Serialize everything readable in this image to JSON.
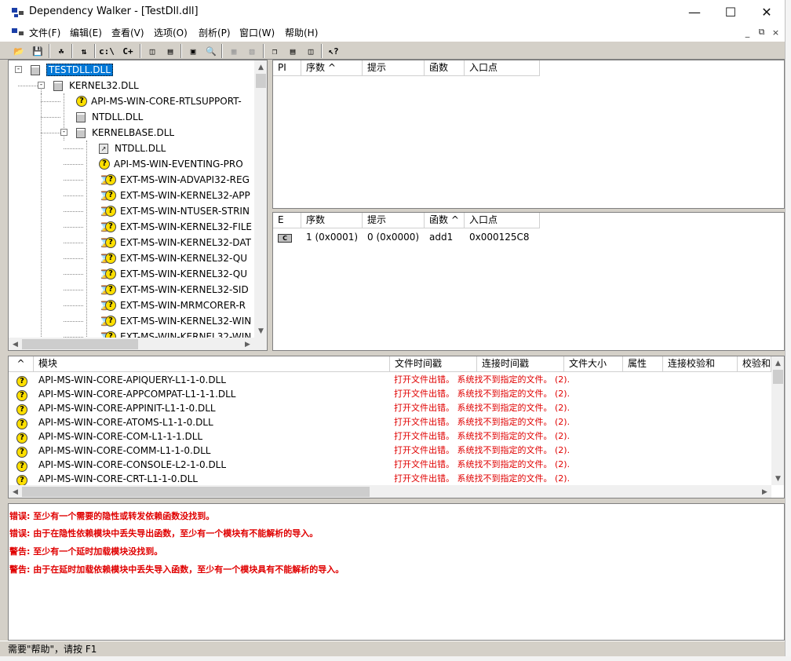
{
  "window": {
    "title": "Dependency Walker - [TestDll.dll]"
  },
  "menu": [
    "文件(F)",
    "编辑(E)",
    "查看(V)",
    "选项(O)",
    "剖析(P)",
    "窗口(W)",
    "帮助(H)"
  ],
  "tree": {
    "nodes": [
      {
        "label": "TESTDLL.DLL",
        "icon": "module-icon",
        "selected": true
      },
      {
        "label": "KERNEL32.DLL",
        "icon": "module-icon"
      },
      {
        "label": "API-MS-WIN-CORE-RTLSUPPORT-",
        "icon": "missing-module-icon"
      },
      {
        "label": "NTDLL.DLL",
        "icon": "module-icon"
      },
      {
        "label": "KERNELBASE.DLL",
        "icon": "module-icon"
      },
      {
        "label": "NTDLL.DLL",
        "icon": "forwarded-module-icon"
      },
      {
        "label": "API-MS-WIN-EVENTING-PRO",
        "icon": "missing-module-icon"
      },
      {
        "label": "EXT-MS-WIN-ADVAPI32-REG",
        "icon": "delay-missing-icon"
      },
      {
        "label": "EXT-MS-WIN-KERNEL32-APP",
        "icon": "delay-missing-icon"
      },
      {
        "label": "EXT-MS-WIN-NTUSER-STRIN",
        "icon": "delay-missing-icon"
      },
      {
        "label": "EXT-MS-WIN-KERNEL32-FILE",
        "icon": "delay-missing-icon"
      },
      {
        "label": "EXT-MS-WIN-KERNEL32-DAT",
        "icon": "delay-missing-icon"
      },
      {
        "label": "EXT-MS-WIN-KERNEL32-QU",
        "icon": "delay-missing-icon"
      },
      {
        "label": "EXT-MS-WIN-KERNEL32-QU",
        "icon": "delay-missing-icon"
      },
      {
        "label": "EXT-MS-WIN-KERNEL32-SID",
        "icon": "delay-missing-icon"
      },
      {
        "label": "EXT-MS-WIN-MRMCORER-R",
        "icon": "delay-missing-icon"
      },
      {
        "label": "EXT-MS-WIN-KERNEL32-WIN",
        "icon": "delay-missing-icon"
      },
      {
        "label": "EXT-MS-WIN-KERNEL32-WIN",
        "icon": "delay-missing-icon"
      }
    ]
  },
  "import_list": {
    "headers": [
      "PI",
      "序数 ^",
      "提示",
      "函数",
      "入口点"
    ]
  },
  "export_list": {
    "headers": [
      "E",
      "序数",
      "提示",
      "函数 ^",
      "入口点"
    ],
    "rows": [
      {
        "icon": "c-function-icon",
        "ordinal": "1 (0x0001)",
        "hint": "0 (0x0000)",
        "function": "add1",
        "entry": "0x000125C8"
      }
    ]
  },
  "module_list": {
    "headers": [
      "^",
      "模块",
      "文件时间戳",
      "连接时间戳",
      "文件大小",
      "属性",
      "连接校验和",
      "校验和"
    ],
    "rows": [
      {
        "module": "API-MS-WIN-CORE-APIQUERY-L1-1-0.DLL",
        "error": "打开文件出错。 系统找不到指定的文件。 (2)."
      },
      {
        "module": "API-MS-WIN-CORE-APPCOMPAT-L1-1-1.DLL",
        "error": "打开文件出错。 系统找不到指定的文件。 (2)."
      },
      {
        "module": "API-MS-WIN-CORE-APPINIT-L1-1-0.DLL",
        "error": "打开文件出错。 系统找不到指定的文件。 (2)."
      },
      {
        "module": "API-MS-WIN-CORE-ATOMS-L1-1-0.DLL",
        "error": "打开文件出错。 系统找不到指定的文件。 (2)."
      },
      {
        "module": "API-MS-WIN-CORE-COM-L1-1-1.DLL",
        "error": "打开文件出错。 系统找不到指定的文件。 (2)."
      },
      {
        "module": "API-MS-WIN-CORE-COMM-L1-1-0.DLL",
        "error": "打开文件出错。 系统找不到指定的文件。 (2)."
      },
      {
        "module": "API-MS-WIN-CORE-CONSOLE-L2-1-0.DLL",
        "error": "打开文件出错。 系统找不到指定的文件。 (2)."
      },
      {
        "module": "API-MS-WIN-CORE-CRT-L1-1-0.DLL",
        "error": "打开文件出错。 系统找不到指定的文件。 (2)."
      }
    ]
  },
  "log": [
    "错误: 至少有一个需要的隐性或转发依赖函数没找到。",
    "错误: 由于在隐性依赖模块中丢失导出函数，至少有一个模块有不能解析的导入。",
    "警告: 至少有一个延时加载模块没找到。",
    "警告: 由于在延时加载依赖模块中丢失导入函数，至少有一个模块具有不能解析的导入。"
  ],
  "status": "需要\"帮助\"，请按 F1",
  "colors": {
    "error": "#e00000",
    "selection": "#0078d7"
  }
}
